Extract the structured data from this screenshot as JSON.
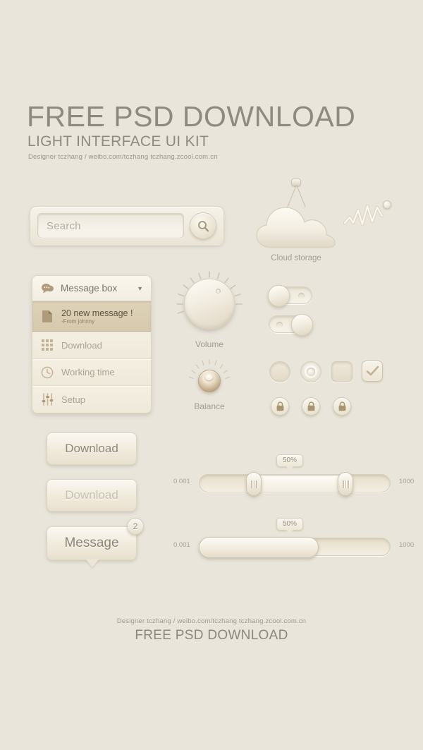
{
  "header": {
    "title": "FREE PSD DOWNLOAD",
    "subtitle": "LIGHT INTERFACE UI KIT",
    "credit": "Designer  tczhang  /  weibo.com/tczhang    tczhang.zcool.com.cn"
  },
  "search": {
    "placeholder": "Search",
    "value": "",
    "icon": "search-icon"
  },
  "cloud": {
    "label": "Cloud storage",
    "icon": "cloud-icon"
  },
  "graph": {
    "icon": "line-chart-icon"
  },
  "message_box": {
    "header_label": "Message box",
    "header_icon": "chat-bubble-icon",
    "caret": "▼",
    "items": [
      {
        "title": "20 new message !",
        "subtitle": "-From johnny",
        "icon": "document-icon",
        "active": true
      },
      {
        "title": "Download",
        "icon": "grid-icon",
        "active": false
      },
      {
        "title": "Working time",
        "icon": "clock-icon",
        "active": false
      },
      {
        "title": "Setup",
        "icon": "sliders-icon",
        "active": false
      }
    ]
  },
  "knobs": [
    {
      "label": "Volume",
      "name": "volume-knob"
    },
    {
      "label": "Balance",
      "name": "balance-knob"
    }
  ],
  "toggles": [
    {
      "name": "toggle-switch-off",
      "state": "off"
    },
    {
      "name": "toggle-switch-on",
      "state": "on"
    }
  ],
  "controls": [
    {
      "name": "radio-unchecked",
      "type": "round"
    },
    {
      "name": "radio-checked",
      "type": "radio"
    },
    {
      "name": "checkbox-unchecked",
      "type": "square"
    },
    {
      "name": "checkbox-checked",
      "type": "checked",
      "glyph": "✓"
    }
  ],
  "lock_buttons": [
    {
      "name": "lock-button-1",
      "icon": "lock-icon"
    },
    {
      "name": "lock-button-2",
      "icon": "lock-icon"
    },
    {
      "name": "lock-button-3",
      "icon": "lock-icon"
    }
  ],
  "buttons": {
    "download": "Download",
    "download_disabled": "Download",
    "message": "Message",
    "message_badge": "2"
  },
  "sliders": [
    {
      "name": "range-slider",
      "min_label": "0.001",
      "max_label": "1000",
      "tooltip": "50%",
      "type": "range",
      "low_percent": 29,
      "high_percent": 76
    },
    {
      "name": "value-slider",
      "min_label": "0.001",
      "max_label": "1000",
      "tooltip": "50%",
      "type": "single",
      "value_percent": 50
    }
  ],
  "footer": {
    "credit": "Designer  tczhang  /  weibo.com/tczhang    tczhang.zcool.com.cn",
    "title": "FREE PSD DOWNLOAD"
  },
  "colors": {
    "background": "#e9e5db",
    "text_primary": "#8f8a7e",
    "text_muted": "#a8a193",
    "panel_light": "#f7f3ea",
    "panel_dark": "#e2dac6",
    "accent_active": "#d6c9ad",
    "icon_brown": "#a99579"
  }
}
